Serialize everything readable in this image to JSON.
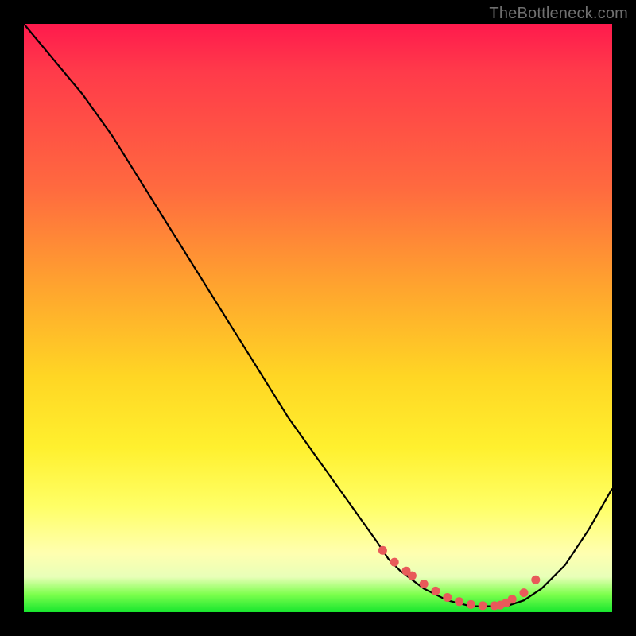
{
  "watermark": "TheBottleneck.com",
  "chart_data": {
    "type": "line",
    "title": "",
    "xlabel": "",
    "ylabel": "",
    "xlim": [
      0,
      100
    ],
    "ylim": [
      0,
      100
    ],
    "series": [
      {
        "name": "curve",
        "x": [
          0,
          5,
          10,
          15,
          20,
          25,
          30,
          35,
          40,
          45,
          50,
          55,
          60,
          62,
          64,
          68,
          72,
          76,
          80,
          82,
          85,
          88,
          92,
          96,
          100
        ],
        "values": [
          100,
          94,
          88,
          81,
          73,
          65,
          57,
          49,
          41,
          33,
          26,
          19,
          12,
          9,
          7,
          4,
          2,
          1,
          1,
          1,
          2,
          4,
          8,
          14,
          21
        ]
      }
    ],
    "markers": {
      "name": "red-dots",
      "color": "#e85a5a",
      "x": [
        61,
        63,
        65,
        66,
        68,
        70,
        72,
        74,
        76,
        78,
        80,
        81,
        82,
        83,
        85,
        87
      ],
      "values": [
        10.5,
        8.5,
        7.0,
        6.2,
        4.8,
        3.6,
        2.5,
        1.8,
        1.3,
        1.1,
        1.1,
        1.2,
        1.6,
        2.2,
        3.3,
        5.5
      ]
    }
  }
}
